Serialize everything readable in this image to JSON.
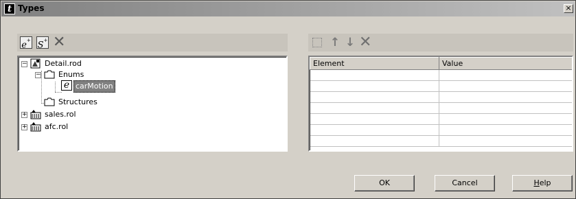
{
  "window": {
    "title": "Types",
    "title_icon": "italic-t-icon",
    "close_glyph": "×"
  },
  "left_toolbar": {
    "buttons": [
      {
        "name": "new-enum-button",
        "glyph": "e"
      },
      {
        "name": "new-structure-button",
        "glyph": "S"
      },
      {
        "name": "delete-button",
        "glyph": "✕"
      }
    ]
  },
  "tree": {
    "nodes": [
      {
        "label": "Detail.rod",
        "icon": "robot-file-icon",
        "expander": "−"
      },
      {
        "label": "Enums",
        "icon": "folder-icon",
        "expander": "−"
      },
      {
        "label": "carMotion",
        "icon": "enum-icon",
        "selected": true
      },
      {
        "label": "Structures",
        "icon": "folder-icon"
      },
      {
        "label": "sales.rol",
        "icon": "robot-library-icon",
        "expander": "+"
      },
      {
        "label": "afc.rol",
        "icon": "robot-library-icon",
        "expander": "+"
      }
    ]
  },
  "right_toolbar": {
    "buttons": [
      {
        "name": "add-element-button",
        "glyph": "▫"
      },
      {
        "name": "move-up-button",
        "glyph": "↑"
      },
      {
        "name": "move-down-button",
        "glyph": "↓"
      },
      {
        "name": "delete-element-button",
        "glyph": "✕"
      }
    ]
  },
  "grid": {
    "columns": [
      "Element",
      "Value"
    ],
    "rows": [
      [
        "",
        ""
      ],
      [
        "",
        ""
      ],
      [
        "",
        ""
      ],
      [
        "",
        ""
      ],
      [
        "",
        ""
      ],
      [
        "",
        ""
      ],
      [
        "",
        ""
      ]
    ]
  },
  "buttons": {
    "ok": "OK",
    "cancel": "Cancel",
    "help_prefix": "H",
    "help_rest": "elp"
  }
}
